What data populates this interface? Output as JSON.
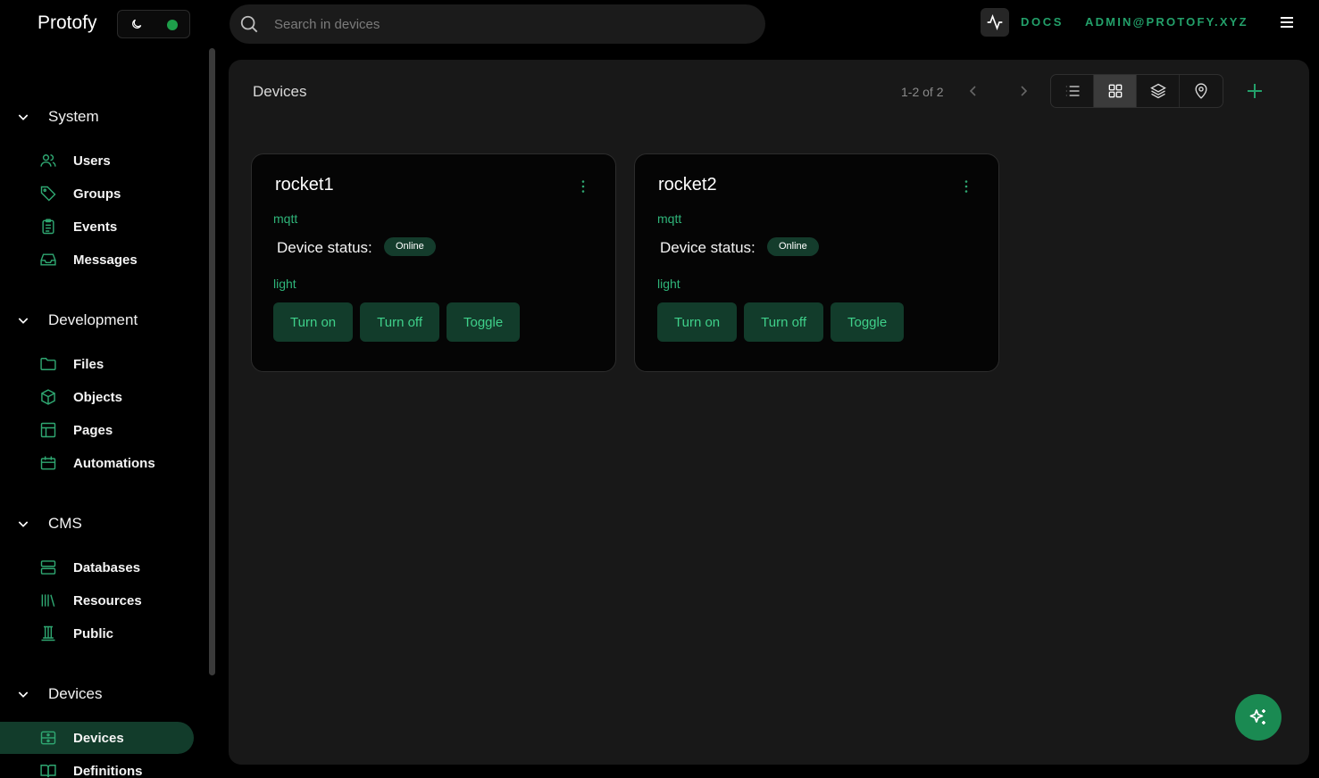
{
  "app": {
    "title": "Protofy"
  },
  "search": {
    "placeholder": "Search in devices"
  },
  "header": {
    "docs_label": "DOCS",
    "user_label": "ADMIN@PROTOFY.XYZ"
  },
  "sidebar": {
    "sections": [
      {
        "title": "System",
        "items": [
          {
            "label": "Users",
            "icon": "users-icon"
          },
          {
            "label": "Groups",
            "icon": "tag-icon"
          },
          {
            "label": "Events",
            "icon": "clipboard-icon"
          },
          {
            "label": "Messages",
            "icon": "inbox-icon"
          }
        ]
      },
      {
        "title": "Development",
        "items": [
          {
            "label": "Files",
            "icon": "folder-icon"
          },
          {
            "label": "Objects",
            "icon": "box-icon"
          },
          {
            "label": "Pages",
            "icon": "layout-icon"
          },
          {
            "label": "Automations",
            "icon": "calendar-icon"
          }
        ]
      },
      {
        "title": "CMS",
        "items": [
          {
            "label": "Databases",
            "icon": "server-icon"
          },
          {
            "label": "Resources",
            "icon": "library-icon"
          },
          {
            "label": "Public",
            "icon": "columns-icon"
          }
        ]
      },
      {
        "title": "Devices",
        "items": [
          {
            "label": "Devices",
            "icon": "router-icon",
            "active": true
          },
          {
            "label": "Definitions",
            "icon": "book-icon"
          }
        ]
      }
    ]
  },
  "main": {
    "title": "Devices",
    "pagination": {
      "text": "1-2 of 2"
    },
    "view_modes": [
      "list",
      "grid",
      "layers",
      "map"
    ],
    "active_view": "grid"
  },
  "devices": [
    {
      "name": "rocket1",
      "protocol": "mqtt",
      "status_label": "Device status:",
      "status": "Online",
      "group": "light",
      "actions": [
        "Turn on",
        "Turn off",
        "Toggle"
      ]
    },
    {
      "name": "rocket2",
      "protocol": "mqtt",
      "status_label": "Device status:",
      "status": "Online",
      "group": "light",
      "actions": [
        "Turn on",
        "Turn off",
        "Toggle"
      ]
    }
  ],
  "colors": {
    "accent": "#23a06a",
    "button_bg": "#123c2b",
    "panel_bg": "#181818"
  }
}
